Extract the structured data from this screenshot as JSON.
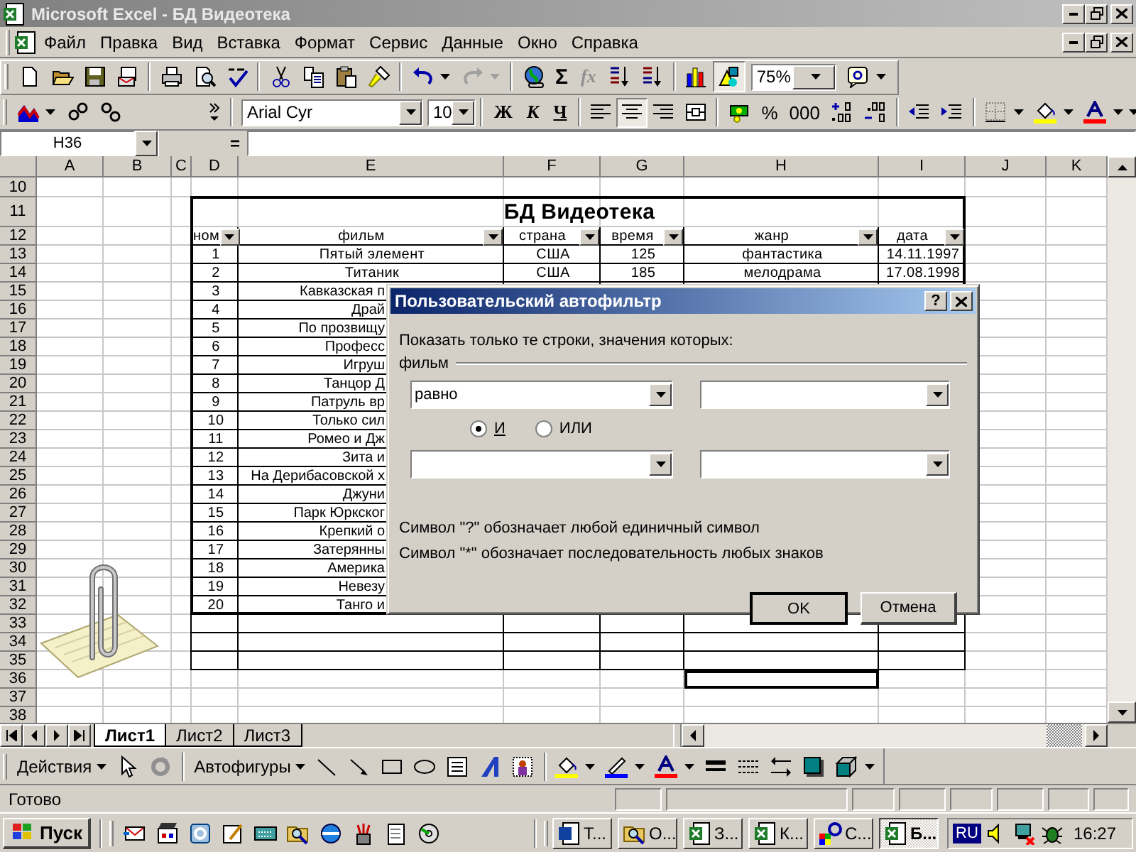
{
  "window": {
    "title": "Microsoft Excel - БД Видеотека"
  },
  "menu": [
    "Файл",
    "Правка",
    "Вид",
    "Вставка",
    "Формат",
    "Сервис",
    "Данные",
    "Окно",
    "Справка"
  ],
  "standard_toolbar": {
    "sum": "Σ",
    "function": "fx",
    "drawing_on": true,
    "zoom": "75%"
  },
  "formatting_toolbar": {
    "font": "Arial Cyr",
    "size": "10",
    "styles": [
      {
        "kind": "bold",
        "label": "Ж"
      },
      {
        "kind": "italic",
        "label": "К"
      },
      {
        "kind": "underline",
        "label": "Ч"
      }
    ],
    "alignment": [
      {
        "kind": "left",
        "selected": false
      },
      {
        "kind": "center",
        "selected": true
      },
      {
        "kind": "right",
        "selected": false
      }
    ],
    "percent": "%",
    "thousands": "000"
  },
  "formula_bar": {
    "name_box": "H36",
    "equals": "="
  },
  "columns": [
    {
      "label": "A",
      "selected": false
    },
    {
      "label": "B",
      "selected": false
    },
    {
      "label": "C",
      "selected": false
    },
    {
      "label": "D",
      "selected": false
    },
    {
      "label": "E",
      "selected": false
    },
    {
      "label": "F",
      "selected": false
    },
    {
      "label": "G",
      "selected": false
    },
    {
      "label": "H",
      "selected": true
    },
    {
      "label": "I",
      "selected": false
    },
    {
      "label": "J",
      "selected": false
    },
    {
      "label": "K",
      "selected": false
    }
  ],
  "rows": [
    {
      "label": "10",
      "selected": false
    },
    {
      "label": "11",
      "selected": false
    },
    {
      "label": "12",
      "selected": false
    },
    {
      "label": "13",
      "selected": false
    },
    {
      "label": "14",
      "selected": false
    },
    {
      "label": "15",
      "selected": false
    },
    {
      "label": "16",
      "selected": false
    },
    {
      "label": "17",
      "selected": false
    },
    {
      "label": "18",
      "selected": false
    },
    {
      "label": "19",
      "selected": false
    },
    {
      "label": "20",
      "selected": false
    },
    {
      "label": "21",
      "selected": false
    },
    {
      "label": "22",
      "selected": false
    },
    {
      "label": "23",
      "selected": false
    },
    {
      "label": "24",
      "selected": false
    },
    {
      "label": "25",
      "selected": false
    },
    {
      "label": "26",
      "selected": false
    },
    {
      "label": "27",
      "selected": false
    },
    {
      "label": "28",
      "selected": false
    },
    {
      "label": "29",
      "selected": false
    },
    {
      "label": "30",
      "selected": false
    },
    {
      "label": "31",
      "selected": false
    },
    {
      "label": "32",
      "selected": false
    },
    {
      "label": "33",
      "selected": false
    },
    {
      "label": "34",
      "selected": false
    },
    {
      "label": "35",
      "selected": false
    },
    {
      "label": "36",
      "selected": true
    },
    {
      "label": "37",
      "selected": false
    },
    {
      "label": "38",
      "selected": false
    }
  ],
  "table": {
    "title": "БД Видеотека",
    "headers": [
      "ном",
      "фильм",
      "страна",
      "время",
      "жанр",
      "дата"
    ],
    "records": [
      {
        "num": "1",
        "film": "Пятый элемент",
        "country": "США",
        "time": "125",
        "genre": "фантастика",
        "date": "14.11.1997"
      },
      {
        "num": "2",
        "film": "Титаник",
        "country": "США",
        "time": "185",
        "genre": "мелодрама",
        "date": "17.08.1998"
      },
      {
        "num": "3",
        "film": "Кавказская п"
      },
      {
        "num": "4",
        "film": "Драй"
      },
      {
        "num": "5",
        "film": "По прозвищу"
      },
      {
        "num": "6",
        "film": "Професс"
      },
      {
        "num": "7",
        "film": "Игруш"
      },
      {
        "num": "8",
        "film": "Танцор Д"
      },
      {
        "num": "9",
        "film": "Патруль вр"
      },
      {
        "num": "10",
        "film": "Только сил"
      },
      {
        "num": "11",
        "film": "Ромео и Дж"
      },
      {
        "num": "12",
        "film": "Зита и"
      },
      {
        "num": "13",
        "film": "На Дерибасовской х"
      },
      {
        "num": "14",
        "film": "Джуни"
      },
      {
        "num": "15",
        "film": "Парк Юркског"
      },
      {
        "num": "16",
        "film": "Крепкий о"
      },
      {
        "num": "17",
        "film": "Затерянны"
      },
      {
        "num": "18",
        "film": "Америка"
      },
      {
        "num": "19",
        "film": "Невезу"
      },
      {
        "num": "20",
        "film": "Танго и"
      }
    ]
  },
  "dialog": {
    "title": "Пользовательский автофильтр",
    "help": "?",
    "prompt": "Показать только те строки, значения которых:",
    "field": "фильм",
    "operator": "равно",
    "connectors": [
      {
        "label": "И",
        "selected": true
      },
      {
        "label": "ИЛИ",
        "selected": false
      }
    ],
    "hints": [
      "Символ \"?\" обозначает любой единичный символ",
      "Символ \"*\" обозначает последовательность любых знаков"
    ],
    "buttons": [
      "OK",
      "Отмена"
    ]
  },
  "sheet_tabs": [
    {
      "label": "Лист1",
      "selected": true
    },
    {
      "label": "Лист2",
      "selected": false
    },
    {
      "label": "Лист3",
      "selected": false
    }
  ],
  "drawing_toolbar": {
    "actions": "Действия",
    "autoshapes": "Автофигуры"
  },
  "status_bar": {
    "text": "Готово"
  },
  "taskbar": {
    "start": "Пуск",
    "tasks": [
      {
        "kind": "word",
        "label": "Т...",
        "selected": false
      },
      {
        "kind": "search",
        "label": "О...",
        "selected": false
      },
      {
        "kind": "excel",
        "label": "З...",
        "selected": false
      },
      {
        "kind": "excel",
        "label": "К...",
        "selected": false
      },
      {
        "kind": "help",
        "label": "С...",
        "selected": false
      },
      {
        "kind": "excel",
        "label": "Б...",
        "selected": true
      }
    ],
    "language": "RU",
    "clock": "16:27"
  }
}
